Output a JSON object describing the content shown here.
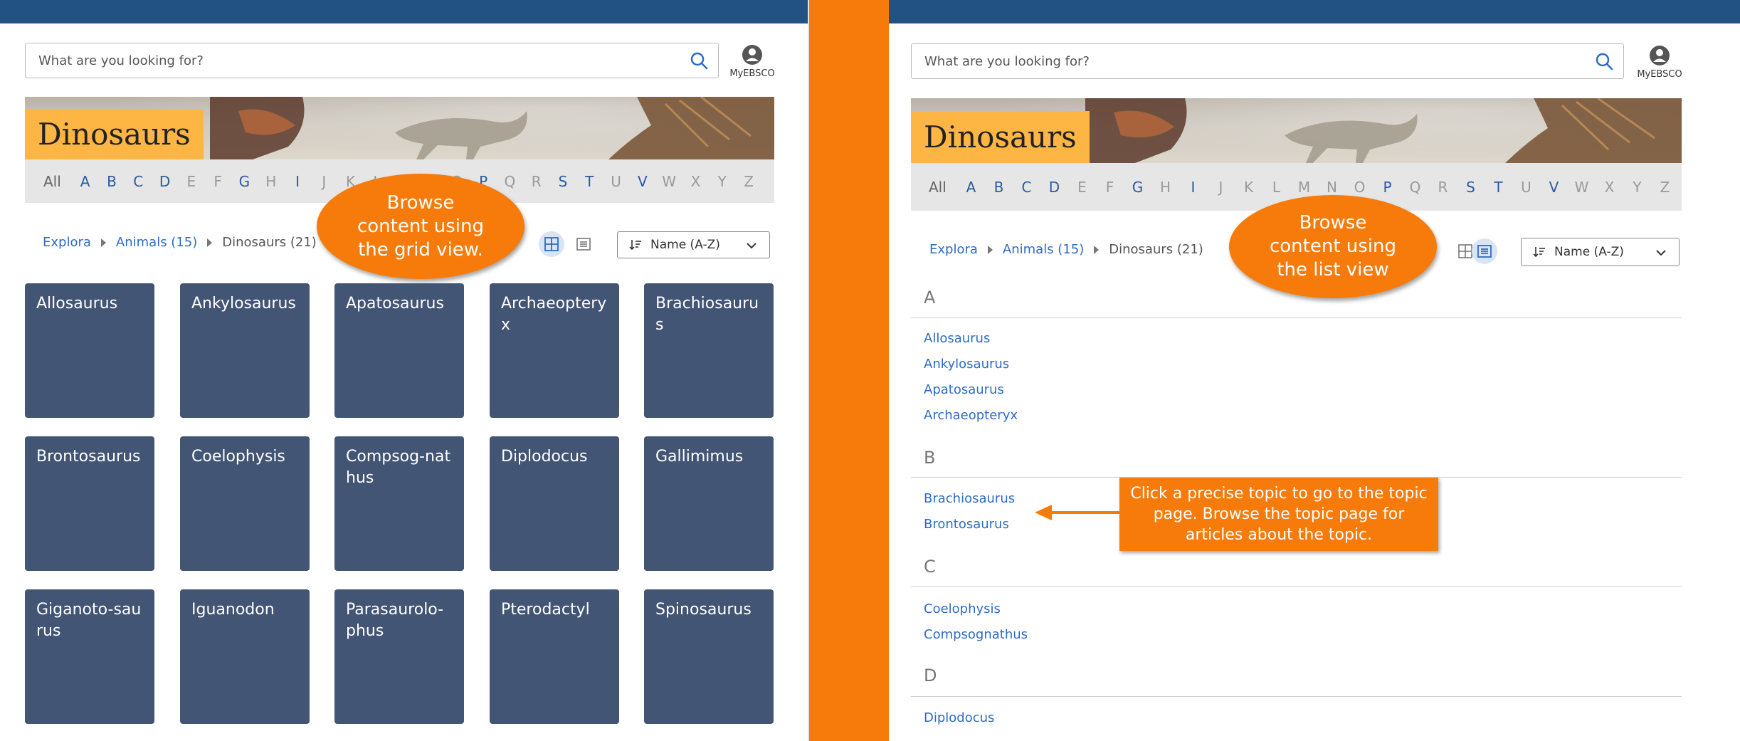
{
  "left": {
    "search": {
      "placeholder": "What are you looking for?"
    },
    "account_label": "MyEBSCO",
    "banner_title": "Dinosaurs",
    "alphabet": [
      {
        "l": "All",
        "s": "all"
      },
      {
        "l": "A",
        "s": "on"
      },
      {
        "l": "B",
        "s": "on"
      },
      {
        "l": "C",
        "s": "on"
      },
      {
        "l": "D",
        "s": "on"
      },
      {
        "l": "E",
        "s": "off"
      },
      {
        "l": "F",
        "s": "off"
      },
      {
        "l": "G",
        "s": "on"
      },
      {
        "l": "H",
        "s": "off"
      },
      {
        "l": "I",
        "s": "on"
      },
      {
        "l": "J",
        "s": "off"
      },
      {
        "l": "K",
        "s": "off"
      },
      {
        "l": "L",
        "s": "off"
      },
      {
        "l": "M",
        "s": "off"
      },
      {
        "l": "N",
        "s": "off"
      },
      {
        "l": "O",
        "s": "off"
      },
      {
        "l": "P",
        "s": "on"
      },
      {
        "l": "Q",
        "s": "off"
      },
      {
        "l": "R",
        "s": "off"
      },
      {
        "l": "S",
        "s": "on"
      },
      {
        "l": "T",
        "s": "on"
      },
      {
        "l": "U",
        "s": "off"
      },
      {
        "l": "V",
        "s": "on"
      },
      {
        "l": "W",
        "s": "off"
      },
      {
        "l": "X",
        "s": "off"
      },
      {
        "l": "Y",
        "s": "off"
      },
      {
        "l": "Z",
        "s": "off"
      }
    ],
    "breadcrumb": [
      "Explora",
      "Animals (15)",
      "Dinosaurs (21)"
    ],
    "sort_label": "Name (A-Z)",
    "callout": "Browse content using the grid view.",
    "tiles": [
      "Allosaurus",
      "Ankylosaurus",
      "Apatosaurus",
      "Archaeopteryx",
      "Brachiosaurus",
      "Brontosaurus",
      "Coelophysis",
      "Compsog-nathus",
      "Diplodocus",
      "Gallimimus",
      "Giganoto-saurus",
      "Iguanodon",
      "Parasaurolo-phus",
      "Pterodactyl",
      "Spinosaurus"
    ]
  },
  "right": {
    "search": {
      "placeholder": "What are you looking for?"
    },
    "account_label": "MyEBSCO",
    "banner_title": "Dinosaurs",
    "breadcrumb": [
      "Explora",
      "Animals (15)",
      "Dinosaurs (21)"
    ],
    "sort_label": "Name (A-Z)",
    "callout": "Browse content using the list view",
    "callout_topic": "Click a precise topic to go to the topic page. Browse the topic page for articles about the topic.",
    "groups": [
      {
        "letter": "A",
        "items": [
          "Allosaurus",
          "Ankylosaurus",
          "Apatosaurus",
          "Archaeopteryx"
        ]
      },
      {
        "letter": "B",
        "items": [
          "Brachiosaurus",
          "Brontosaurus"
        ]
      },
      {
        "letter": "C",
        "items": [
          "Coelophysis",
          "Compsognathus"
        ]
      },
      {
        "letter": "D",
        "items": [
          "Diplodocus"
        ]
      }
    ]
  },
  "colors": {
    "topbar": "#215283",
    "accent_orange": "#f77b0b",
    "tile": "#425574",
    "link": "#2e6bc6",
    "banner_title_bg": "#fdb643"
  },
  "icons": [
    "search-icon",
    "account-icon",
    "grid-view-icon",
    "list-view-icon",
    "sort-icon",
    "chevron-down-icon",
    "arrow-left-icon"
  ]
}
